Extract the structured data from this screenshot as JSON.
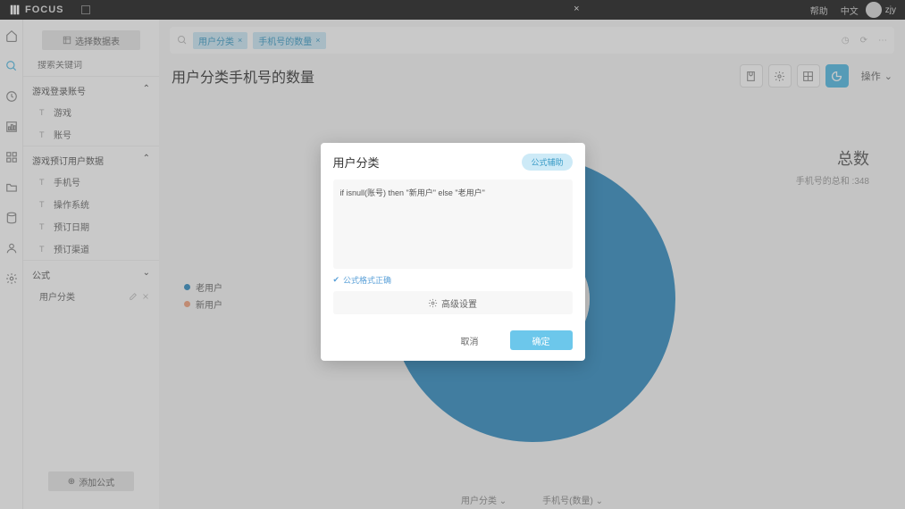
{
  "topbar": {
    "brand": "FOCUS",
    "help": "帮助",
    "lang": "中文",
    "user": "zjy"
  },
  "sidebar": {
    "pick_table": "选择数据表",
    "search_placeholder": "搜索关键词",
    "groups": [
      {
        "title": "游戏登录账号",
        "fields": [
          {
            "icon": "T",
            "label": "游戏"
          },
          {
            "icon": "T",
            "label": "账号"
          }
        ]
      },
      {
        "title": "游戏预订用户数据",
        "fields": [
          {
            "icon": "T",
            "label": "手机号"
          },
          {
            "icon": "T",
            "label": "操作系统"
          },
          {
            "icon": "T",
            "label": "预订日期"
          },
          {
            "icon": "T",
            "label": "预订渠道"
          }
        ]
      }
    ],
    "formula_section": "公式",
    "formula_item": "用户分类",
    "add_formula": "添加公式"
  },
  "query": {
    "chips": [
      "用户分类",
      "手机号的数量"
    ]
  },
  "title": "用户分类手机号的数量",
  "actions": {
    "operate": "操作"
  },
  "legend": [
    {
      "color": "#2e8bc0",
      "label": "老用户"
    },
    {
      "color": "#f2a07b",
      "label": "新用户"
    }
  ],
  "totals": {
    "label": "总数",
    "sub_prefix": "手机号的总和 :",
    "sub_value": "348"
  },
  "chart_data": {
    "type": "pie",
    "title": "用户分类手机号的数量",
    "series": [
      {
        "name": "老用户",
        "value": 328,
        "color": "#2e8bc0"
      },
      {
        "name": "新用户",
        "value": 20,
        "color": "#f2a07b"
      }
    ],
    "total": 348
  },
  "footer": {
    "left": "用户分类",
    "right": "手机号(数量)"
  },
  "modal": {
    "title": "用户分类",
    "help_btn": "公式辅助",
    "formula": "if isnull(账号) then \"新用户\" else \"老用户\"",
    "valid": "公式格式正确",
    "advanced": "高级设置",
    "cancel": "取消",
    "ok": "确定"
  }
}
